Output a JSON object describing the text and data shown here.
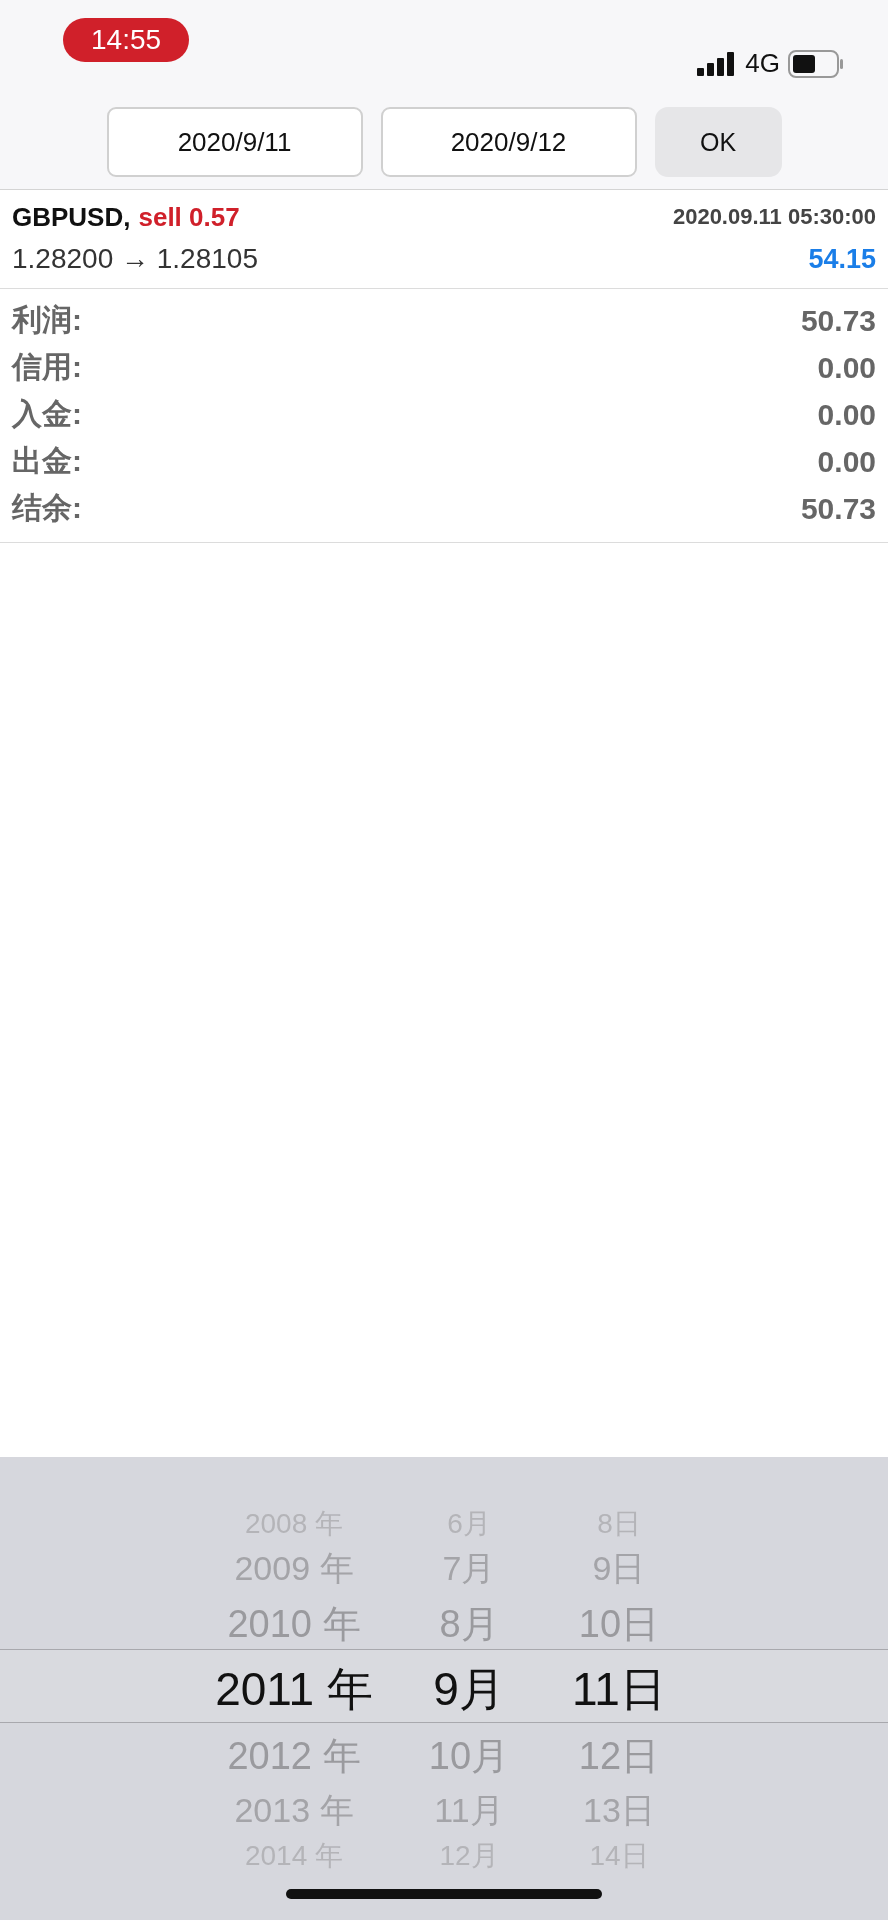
{
  "status_bar": {
    "time": "14:55",
    "network": "4G"
  },
  "date_range": {
    "from": "2020/9/11",
    "to": "2020/9/12",
    "ok": "OK"
  },
  "trade": {
    "symbol": "GBPUSD,",
    "side": "sell 0.57",
    "time": "2020.09.11 05:30:00",
    "prices": "1.28200 → 1.28105",
    "profit": "54.15"
  },
  "summary": [
    {
      "label": "利润:",
      "value": "50.73"
    },
    {
      "label": "信用:",
      "value": "0.00"
    },
    {
      "label": "入金:",
      "value": "0.00"
    },
    {
      "label": "出金:",
      "value": "0.00"
    },
    {
      "label": "结余:",
      "value": "50.73"
    }
  ],
  "picker": {
    "columns": [
      {
        "items": [
          {
            "label": "2008 年",
            "selected": false
          },
          {
            "label": "2009 年",
            "selected": false
          },
          {
            "label": "2010 年",
            "selected": false
          },
          {
            "label": "2011 年",
            "selected": true
          },
          {
            "label": "2012 年",
            "selected": false
          },
          {
            "label": "2013 年",
            "selected": false
          },
          {
            "label": "2014 年",
            "selected": false
          }
        ]
      },
      {
        "items": [
          {
            "label": "6月",
            "selected": false
          },
          {
            "label": "7月",
            "selected": false
          },
          {
            "label": "8月",
            "selected": false
          },
          {
            "label": "9月",
            "selected": true
          },
          {
            "label": "10月",
            "selected": false
          },
          {
            "label": "11月",
            "selected": false
          },
          {
            "label": "12月",
            "selected": false
          }
        ]
      },
      {
        "items": [
          {
            "label": "8日",
            "selected": false
          },
          {
            "label": "9日",
            "selected": false
          },
          {
            "label": "10日",
            "selected": false
          },
          {
            "label": "11日",
            "selected": true
          },
          {
            "label": "12日",
            "selected": false
          },
          {
            "label": "13日",
            "selected": false
          },
          {
            "label": "14日",
            "selected": false
          }
        ]
      }
    ]
  }
}
